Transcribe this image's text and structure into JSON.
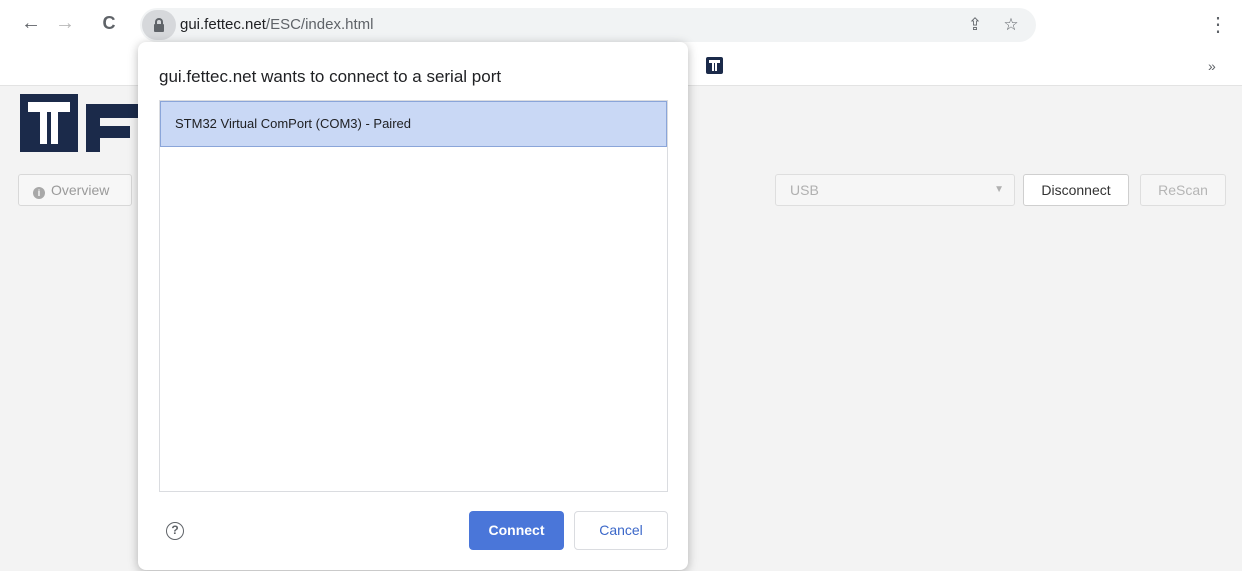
{
  "browser": {
    "back_icon": "←",
    "forward_icon": "→",
    "reload_icon": "C",
    "url_host": "gui.fettec.net",
    "url_path": "/ESC/index.html",
    "share_icon": "⇪",
    "star_icon": "☆",
    "menu_icon": "⋮",
    "bookmarks_more": "»"
  },
  "page": {
    "overview_label": "Overview",
    "port_select_value": "USB",
    "disconnect_label": "Disconnect",
    "rescan_label": "ReScan"
  },
  "dialog": {
    "title": "gui.fettec.net wants to connect to a serial port",
    "ports": [
      {
        "label": "STM32 Virtual ComPort (COM3) - Paired",
        "selected": true
      }
    ],
    "help_glyph": "?",
    "connect_label": "Connect",
    "cancel_label": "Cancel"
  },
  "colors": {
    "brand_navy": "#1b2a4a",
    "connect_blue": "#4a76d9",
    "selected_row": "#c9d8f5"
  }
}
